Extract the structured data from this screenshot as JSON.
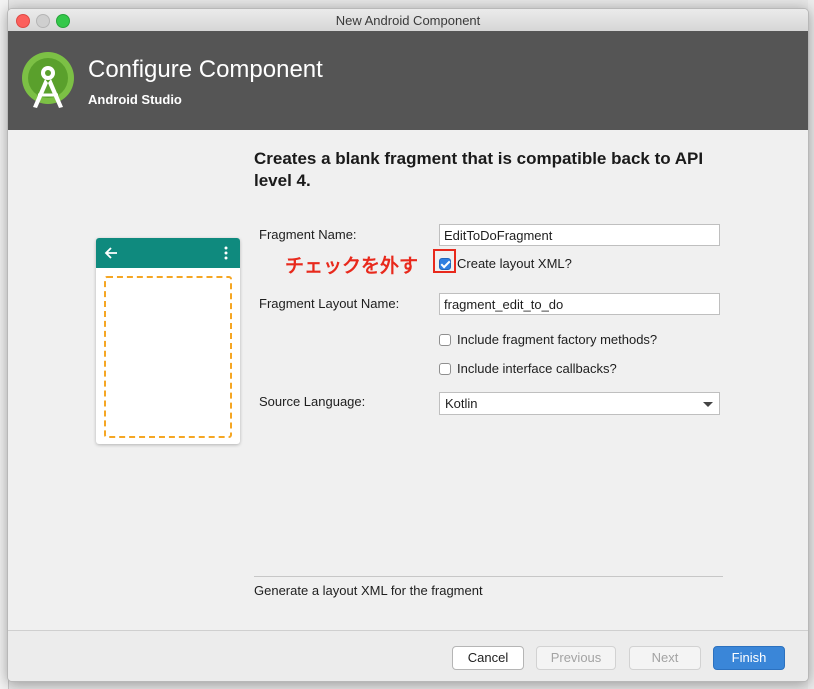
{
  "window": {
    "title": "New Android Component"
  },
  "header": {
    "title": "Configure Component",
    "subtitle": "Android Studio"
  },
  "description": "Creates a blank fragment that is compatible back to API level 4.",
  "form": {
    "fragment_name_label": "Fragment Name:",
    "fragment_name_value": "EditToDoFragment",
    "create_layout_label": "Create layout XML?",
    "create_layout_checked": true,
    "layout_name_label": "Fragment Layout Name:",
    "layout_name_value": "fragment_edit_to_do",
    "factory_methods_label": "Include fragment factory methods?",
    "factory_methods_checked": false,
    "interface_callbacks_label": "Include interface callbacks?",
    "interface_callbacks_checked": false,
    "source_language_label": "Source Language:",
    "source_language_value": "Kotlin"
  },
  "annotation": "チェックを外す",
  "help_text": "Generate a layout XML for the fragment",
  "buttons": {
    "cancel": "Cancel",
    "previous": "Previous",
    "next": "Next",
    "finish": "Finish"
  },
  "colors": {
    "header_bg": "#555555",
    "preview_bar": "#0f8a7e",
    "preview_dash": "#f5a623",
    "annotation": "#e8291c",
    "primary": "#3a86d8"
  },
  "icons": [
    "android-studio-logo",
    "back-arrow-icon",
    "overflow-menu-icon",
    "chevron-down-icon"
  ]
}
